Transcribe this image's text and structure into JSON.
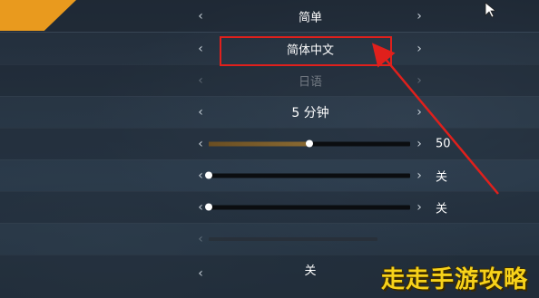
{
  "settings": {
    "rows": [
      {
        "value": "简单",
        "left_arrow": "‹",
        "right_arrow": "›"
      },
      {
        "value": "简体中文",
        "left_arrow": "‹",
        "right_arrow": "›"
      },
      {
        "value": "日语",
        "left_arrow": "‹",
        "right_arrow": "›"
      },
      {
        "value": "5 分钟",
        "left_arrow": "‹",
        "right_arrow": "›"
      },
      {
        "slider_level": 0.5,
        "side_label": "50",
        "left_arrow": "‹",
        "right_arrow": "›"
      },
      {
        "slider_level": 0.0,
        "side_label": "关",
        "left_arrow": "‹",
        "right_arrow": "›"
      },
      {
        "slider_level": 0.0,
        "side_label": "关",
        "left_arrow": "‹",
        "right_arrow": "›"
      },
      {
        "left_arrow": "‹"
      },
      {
        "value": "关",
        "left_arrow": "‹",
        "right_arrow": "›"
      }
    ]
  },
  "colors": {
    "accent_tab": "#e99a1e",
    "highlight": "#e0201c",
    "slider_fill": "#8a6a32",
    "watermark": "#f7d21a"
  },
  "icons": {
    "cursor": "mouse-pointer-icon",
    "annotation_arrow": "red-arrow-icon"
  },
  "watermark": {
    "text": "走走手游攻略"
  }
}
